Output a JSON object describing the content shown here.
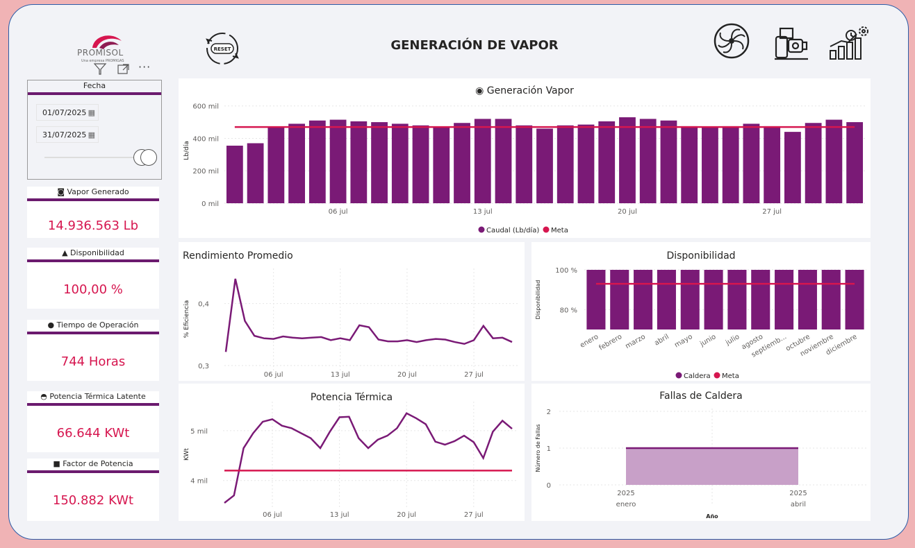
{
  "header": {
    "title": "GENERACIÓN DE VAPOR",
    "logo_text": "PROMISOL",
    "logo_sub": "Una empresa PROMIGAS",
    "reset_label": "RESET"
  },
  "toolbar_icons": [
    "filter-icon",
    "focus-mode-icon",
    "more-options-icon"
  ],
  "header_icons": [
    "turbine-icon",
    "boiler-icon",
    "performance-chart-icon"
  ],
  "filter": {
    "title": "Fecha",
    "start_date": "01/07/2025",
    "end_date": "31/07/2025"
  },
  "kpis": [
    {
      "icon": "◙",
      "label": "Vapor Generado",
      "value": "14.936.563 Lb"
    },
    {
      "icon": "▲",
      "label": "Disponibilidad",
      "value": "100,00 %"
    },
    {
      "icon": "●",
      "label": "Tiempo de Operación",
      "value": "744 Horas"
    },
    {
      "icon": "◓",
      "label": "Potencia Térmica Latente",
      "value": "66.644 KWt"
    },
    {
      "icon": "■",
      "label": "Factor de Potencia",
      "value": "150.882 KWt"
    }
  ],
  "colors": {
    "bar": "#7a1a76",
    "meta": "#d6164f",
    "line": "#7a1a76",
    "area": "#c8a0c8",
    "value": "#d6164f"
  },
  "chart_data": [
    {
      "type": "bar",
      "title": "◉ Generación Vapor",
      "ylabel": "Lb/día",
      "ylim": [
        0,
        650000
      ],
      "y_ticks": [
        "0 mil",
        "200 mil",
        "400 mil",
        "600 mil"
      ],
      "x_ticks": [
        "06 jul",
        "13 jul",
        "20 jul",
        "27 jul"
      ],
      "legend": [
        "Caudal (Lb/día)",
        "Meta"
      ],
      "legend_position": "bottom-center",
      "categories": [
        "01 jul",
        "02 jul",
        "03 jul",
        "04 jul",
        "05 jul",
        "06 jul",
        "07 jul",
        "08 jul",
        "09 jul",
        "10 jul",
        "11 jul",
        "12 jul",
        "13 jul",
        "14 jul",
        "15 jul",
        "16 jul",
        "17 jul",
        "18 jul",
        "19 jul",
        "20 jul",
        "21 jul",
        "22 jul",
        "23 jul",
        "24 jul",
        "25 jul",
        "26 jul",
        "27 jul",
        "28 jul",
        "29 jul",
        "30 jul",
        "31 jul"
      ],
      "series": [
        {
          "name": "Caudal (Lb/día)",
          "values": [
            355000,
            370000,
            470000,
            490000,
            510000,
            515000,
            505000,
            500000,
            490000,
            480000,
            470000,
            495000,
            520000,
            520000,
            480000,
            460000,
            480000,
            485000,
            505000,
            530000,
            520000,
            510000,
            475000,
            470000,
            475000,
            490000,
            475000,
            440000,
            495000,
            515000,
            500000
          ]
        },
        {
          "name": "Meta",
          "values": [
            470000,
            470000,
            470000,
            470000,
            470000,
            470000,
            470000,
            470000,
            470000,
            470000,
            470000,
            470000,
            470000,
            470000,
            470000,
            470000,
            470000,
            470000,
            470000,
            470000,
            470000,
            470000,
            470000,
            470000,
            470000,
            470000,
            470000,
            470000,
            470000,
            470000,
            470000
          ]
        }
      ]
    },
    {
      "type": "line",
      "title": "Rendimiento Promedio",
      "ylabel": "% Eficiencia",
      "ylim": [
        0.3,
        0.45
      ],
      "y_ticks": [
        "0,3",
        "0,4"
      ],
      "x_ticks": [
        "06 jul",
        "13 jul",
        "20 jul",
        "27 jul"
      ],
      "series": [
        {
          "values": [
            0.322,
            0.44,
            0.372,
            0.348,
            0.344,
            0.343,
            0.347,
            0.345,
            0.344,
            0.345,
            0.346,
            0.341,
            0.344,
            0.341,
            0.365,
            0.362,
            0.342,
            0.339,
            0.339,
            0.341,
            0.338,
            0.341,
            0.343,
            0.342,
            0.338,
            0.335,
            0.341,
            0.364,
            0.344,
            0.345,
            0.338
          ]
        }
      ]
    },
    {
      "type": "bar",
      "title": "Disponibilidad",
      "ylabel": "Disponibilidad",
      "ylim": [
        70,
        100
      ],
      "y_ticks": [
        "80 %",
        "100 %"
      ],
      "legend": [
        "Caldera",
        "Meta"
      ],
      "legend_position": "bottom-center",
      "categories": [
        "enero",
        "febrero",
        "marzo",
        "abril",
        "mayo",
        "junio",
        "julio",
        "agosto",
        "septiemb...",
        "octubre",
        "noviembre",
        "diciembre"
      ],
      "series": [
        {
          "name": "Caldera",
          "values": [
            100,
            100,
            100,
            100,
            100,
            100,
            100,
            100,
            100,
            100,
            100,
            100
          ]
        },
        {
          "name": "Meta",
          "values": [
            93,
            93,
            93,
            93,
            93,
            93,
            93,
            93,
            93,
            93,
            93,
            93
          ]
        }
      ]
    },
    {
      "type": "line",
      "title": "Potencia Térmica",
      "ylabel": "KWt",
      "ylim": [
        3550,
        5500
      ],
      "y_ticks": [
        "4 mil",
        "5 mil"
      ],
      "x_ticks": [
        "06 jul",
        "13 jul",
        "20 jul",
        "27 jul"
      ],
      "series": [
        {
          "values": [
            3550,
            3700,
            4650,
            4950,
            5180,
            5230,
            5100,
            5050,
            4950,
            4850,
            4650,
            4980,
            5270,
            5280,
            4850,
            4650,
            4820,
            4900,
            5050,
            5350,
            5250,
            5130,
            4780,
            4720,
            4790,
            4900,
            4770,
            4450,
            4980,
            5200,
            5040
          ]
        },
        {
          "values": [
            4200,
            4200,
            4200,
            4200,
            4200,
            4200,
            4200,
            4200,
            4200,
            4200,
            4200,
            4200,
            4200,
            4200,
            4200,
            4200,
            4200,
            4200,
            4200,
            4200,
            4200,
            4200,
            4200,
            4200,
            4200,
            4200,
            4200,
            4200,
            4200,
            4200,
            4200
          ]
        }
      ]
    },
    {
      "type": "area",
      "title": "Fallas de Caldera",
      "ylabel": "Número de Fallas",
      "xlabel": "Año",
      "ylim": [
        0,
        2
      ],
      "y_ticks": [
        "0",
        "1",
        "2"
      ],
      "x_ticks": [
        {
          "year": "2025",
          "month": "enero"
        },
        {
          "year": "2025",
          "month": "abril"
        }
      ],
      "series": [
        {
          "values": [
            1,
            1
          ]
        }
      ]
    }
  ]
}
